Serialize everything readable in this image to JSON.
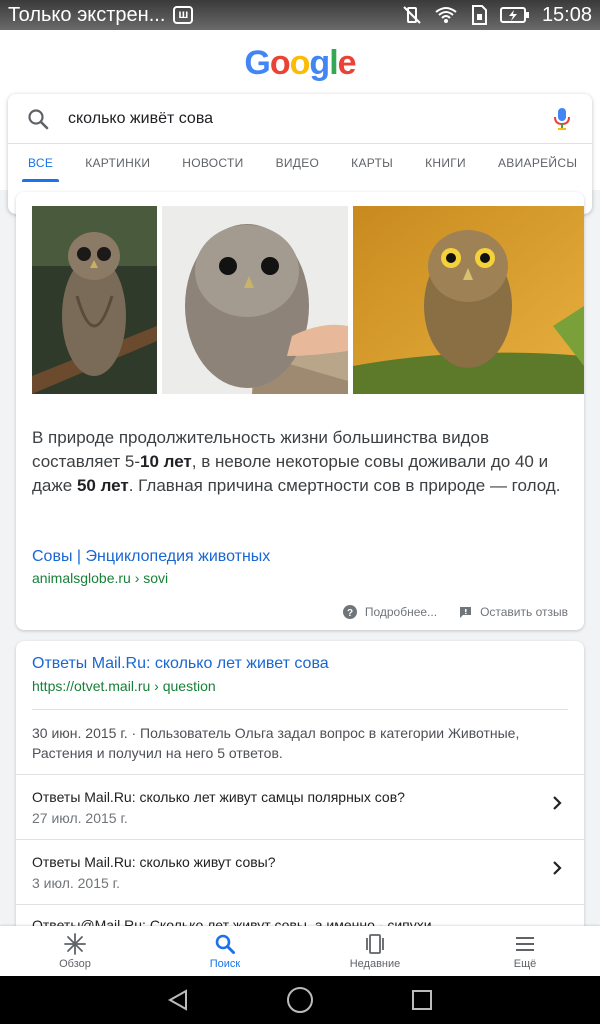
{
  "status_bar": {
    "notification_text": "Только экстрен...",
    "notif_badge": "ш",
    "time": "15:08"
  },
  "google_logo": [
    "G",
    "o",
    "o",
    "g",
    "l",
    "e"
  ],
  "search": {
    "query": "сколько живёт сова"
  },
  "tabs": [
    "ВСЕ",
    "КАРТИНКИ",
    "НОВОСТИ",
    "ВИДЕО",
    "КАРТЫ",
    "КНИГИ",
    "АВИАРЕЙСЫ"
  ],
  "featured": {
    "snippet_part1": "В природе продолжительность жизни большинства видов составляет 5-",
    "snippet_bold1": "10 лет",
    "snippet_part2": ", в неволе некоторые совы доживали до 40 и даже ",
    "snippet_bold2": "50 лет",
    "snippet_part3": ". Главная причина смертности сов в природе — голод.",
    "source_title": "Совы | Энциклопедия животных",
    "source_url": "animalsglobe.ru › sovi",
    "more_label": "Подробнее...",
    "feedback_label": "Оставить отзыв"
  },
  "result": {
    "title": "Ответы Mail.Ru: сколько лет живет сова",
    "url": "https://otvet.mail.ru › question",
    "description": "30 июн. 2015 г. · Пользователь Ольга задал вопрос в категории Животные, Растения и получил на него 5 ответов.",
    "sub_results": [
      {
        "title": "Ответы Mail.Ru: сколько лет живут самцы полярных сов?",
        "date": "27 июл. 2015 г."
      },
      {
        "title": "Ответы Mail.Ru: сколько живут совы?",
        "date": "3 июл. 2015 г."
      },
      {
        "title": "Ответы@Mail.Ru: Сколько лет живут совы, а именно - сипухи"
      }
    ]
  },
  "bottom_nav": [
    {
      "label": "Обзор",
      "icon": "discover-icon"
    },
    {
      "label": "Поиск",
      "icon": "search-icon"
    },
    {
      "label": "Недавние",
      "icon": "recent-icon"
    },
    {
      "label": "Ещё",
      "icon": "menu-icon"
    }
  ],
  "colors": {
    "accent": "#1a73e8",
    "link": "#1967d2",
    "url_green": "#188038"
  }
}
